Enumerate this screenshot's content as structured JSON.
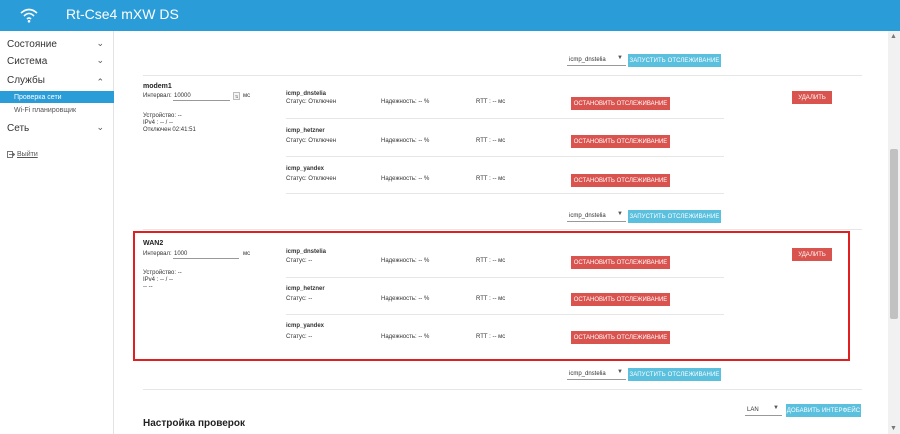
{
  "app": {
    "title": "Rt-Cse4 mXW DS"
  },
  "sidebar": {
    "items": [
      {
        "label": "Состояние"
      },
      {
        "label": "Система"
      },
      {
        "label": "Службы"
      },
      {
        "label": "Сеть"
      }
    ],
    "sub_items": [
      {
        "label": "Проверка сети"
      },
      {
        "label": "Wi-Fi планировщик"
      }
    ],
    "logout": "Выйти"
  },
  "controls": {
    "probe_select": "icmp_dnstelia",
    "start_tracking": "ЗАПУСТИТЬ ОТСЛЕЖИВАНИЕ",
    "stop_tracking": "ОСТАНОВИТЬ ОТСЛЕЖИВАНИЕ",
    "delete": "УДАЛИТЬ",
    "add_interface": "ДОБАВИТЬ ИНТЕРФЕЙС",
    "iface_select": "LAN"
  },
  "interfaces": [
    {
      "name": "modem1",
      "interval_label": "Интервал:",
      "interval_value": "10000",
      "ms": "мс",
      "device": "Устройство: --",
      "ipv4": "IPv4 : -- / --",
      "status": "Отключен 02:41:51",
      "probes": [
        {
          "name": "icmp_dnstelia",
          "status": "Статус: Отключен",
          "reliability": "Надежность: -- %",
          "rtt": "RTT : -- мс"
        },
        {
          "name": "icmp_hetzner",
          "status": "Статус: Отключен",
          "reliability": "Надежность: -- %",
          "rtt": "RTT : -- мс"
        },
        {
          "name": "icmp_yandex",
          "status": "Статус: Отключен",
          "reliability": "Надежность: -- %",
          "rtt": "RTT : -- мс"
        }
      ]
    },
    {
      "name": "WAN2",
      "interval_label": "Интервал:",
      "interval_value": "1000",
      "ms": "мс",
      "device": "Устройство: --",
      "ipv4": "IPv4 : -- / --",
      "status": "-- --",
      "probes": [
        {
          "name": "icmp_dnstelia",
          "status": "Статус: --",
          "reliability": "Надежность: -- %",
          "rtt": "RTT : -- мс"
        },
        {
          "name": "icmp_hetzner",
          "status": "Статус: --",
          "reliability": "Надежность: -- %",
          "rtt": "RTT : -- мс"
        },
        {
          "name": "icmp_yandex",
          "status": "Статус: --",
          "reliability": "Надежность: -- %",
          "rtt": "RTT : -- мс"
        }
      ]
    }
  ],
  "section": {
    "title": "Настройка проверок"
  },
  "colors": {
    "header": "#2a9cd8",
    "start_button": "#5bc0de",
    "stop_button": "#d9534f",
    "highlight": "#e02020"
  }
}
